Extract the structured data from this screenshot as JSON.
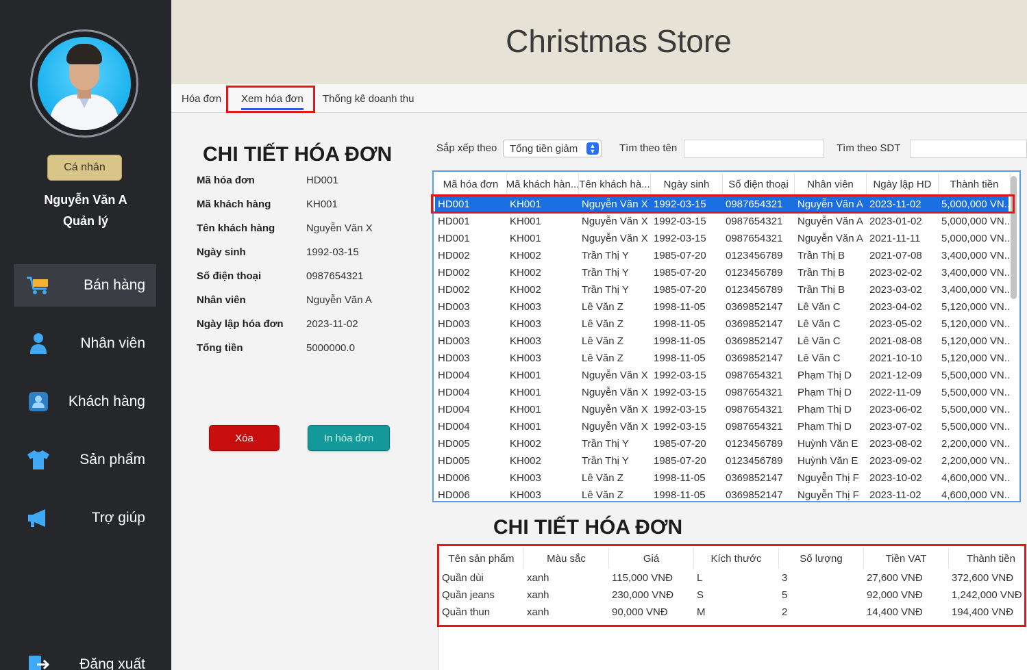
{
  "app": {
    "title": "Christmas Store"
  },
  "user": {
    "personal_label": "Cá nhân",
    "name": "Nguyễn Văn A",
    "role": "Quản lý"
  },
  "nav": [
    {
      "label": "Bán hàng",
      "icon": "cart-icon"
    },
    {
      "label": "Nhân viên",
      "icon": "person-icon"
    },
    {
      "label": "Khách hàng",
      "icon": "customer-icon"
    },
    {
      "label": "Sản phẩm",
      "icon": "shirt-icon"
    },
    {
      "label": "Trợ giúp",
      "icon": "megaphone-icon"
    },
    {
      "label": "Đăng xuất",
      "icon": "logout-icon"
    }
  ],
  "tabs": [
    {
      "label": "Hóa đơn"
    },
    {
      "label": "Xem hóa đơn",
      "active": true
    },
    {
      "label": "Thống kê doanh thu"
    }
  ],
  "detail": {
    "title": "CHI TIẾT HÓA ĐƠN",
    "fields": [
      {
        "label": "Mã hóa đơn",
        "value": "HD001"
      },
      {
        "label": "Mã khách hàng",
        "value": "KH001"
      },
      {
        "label": "Tên khách hàng",
        "value": "Nguyễn Văn X"
      },
      {
        "label": "Ngày sinh",
        "value": "1992-03-15"
      },
      {
        "label": "Số điện thoại",
        "value": "0987654321"
      },
      {
        "label": "Nhân viên",
        "value": "Nguyễn Văn A"
      },
      {
        "label": "Ngày lập hóa đơn",
        "value": "2023-11-02"
      },
      {
        "label": "Tổng tiền",
        "value": "5000000.0"
      }
    ],
    "delete_label": "Xóa",
    "print_label": "In hóa đơn"
  },
  "toolbar": {
    "sort_label": "Sắp xếp theo",
    "sort_value": "Tổng tiền giảm",
    "search_name_label": "Tìm theo tên",
    "search_name_value": "",
    "search_phone_label": "Tìm theo SDT",
    "search_phone_value": ""
  },
  "invoice_table": {
    "columns": [
      "Mã hóa đơn",
      "Mã khách hàn...",
      "Tên khách hà...",
      "Ngày sinh",
      "Số điện thoại",
      "Nhân viên",
      "Ngày lập HD",
      "Thành tiền"
    ],
    "selected_row": 0,
    "rows": [
      [
        "HD001",
        "KH001",
        "Nguyễn Văn X",
        "1992-03-15",
        "0987654321",
        "Nguyễn Văn A",
        "2023-11-02",
        "5,000,000 VN..."
      ],
      [
        "HD001",
        "KH001",
        "Nguyễn Văn X",
        "1992-03-15",
        "0987654321",
        "Nguyễn Văn A",
        "2023-01-02",
        "5,000,000 VN..."
      ],
      [
        "HD001",
        "KH001",
        "Nguyễn Văn X",
        "1992-03-15",
        "0987654321",
        "Nguyễn Văn A",
        "2021-11-11",
        "5,000,000 VN..."
      ],
      [
        "HD002",
        "KH002",
        "Trần Thị Y",
        "1985-07-20",
        "0123456789",
        "Trần Thị B",
        "2021-07-08",
        "3,400,000 VN..."
      ],
      [
        "HD002",
        "KH002",
        "Trần Thị Y",
        "1985-07-20",
        "0123456789",
        "Trần Thị B",
        "2023-02-02",
        "3,400,000 VN..."
      ],
      [
        "HD002",
        "KH002",
        "Trần Thị Y",
        "1985-07-20",
        "0123456789",
        "Trần Thị B",
        "2023-03-02",
        "3,400,000 VN..."
      ],
      [
        "HD003",
        "KH003",
        "Lê Văn Z",
        "1998-11-05",
        "0369852147",
        "Lê Văn C",
        "2023-04-02",
        "5,120,000 VN..."
      ],
      [
        "HD003",
        "KH003",
        "Lê Văn Z",
        "1998-11-05",
        "0369852147",
        "Lê Văn C",
        "2023-05-02",
        "5,120,000 VN..."
      ],
      [
        "HD003",
        "KH003",
        "Lê Văn Z",
        "1998-11-05",
        "0369852147",
        "Lê Văn C",
        "2021-08-08",
        "5,120,000 VN..."
      ],
      [
        "HD003",
        "KH003",
        "Lê Văn Z",
        "1998-11-05",
        "0369852147",
        "Lê Văn C",
        "2021-10-10",
        "5,120,000 VN..."
      ],
      [
        "HD004",
        "KH001",
        "Nguyễn Văn X",
        "1992-03-15",
        "0987654321",
        "Phạm Thị D",
        "2021-12-09",
        "5,500,000 VN..."
      ],
      [
        "HD004",
        "KH001",
        "Nguyễn Văn X",
        "1992-03-15",
        "0987654321",
        "Phạm Thị D",
        "2022-11-09",
        "5,500,000 VN..."
      ],
      [
        "HD004",
        "KH001",
        "Nguyễn Văn X",
        "1992-03-15",
        "0987654321",
        "Phạm Thị D",
        "2023-06-02",
        "5,500,000 VN..."
      ],
      [
        "HD004",
        "KH001",
        "Nguyễn Văn X",
        "1992-03-15",
        "0987654321",
        "Phạm Thị D",
        "2023-07-02",
        "5,500,000 VN..."
      ],
      [
        "HD005",
        "KH002",
        "Trần Thị Y",
        "1985-07-20",
        "0123456789",
        "Huỳnh Văn E",
        "2023-08-02",
        "2,200,000 VN..."
      ],
      [
        "HD005",
        "KH002",
        "Trần Thị Y",
        "1985-07-20",
        "0123456789",
        "Huỳnh Văn E",
        "2023-09-02",
        "2,200,000 VN..."
      ],
      [
        "HD006",
        "KH003",
        "Lê Văn Z",
        "1998-11-05",
        "0369852147",
        "Nguyễn Thị F",
        "2023-10-02",
        "4,600,000 VN..."
      ],
      [
        "HD006",
        "KH003",
        "Lê Văn Z",
        "1998-11-05",
        "0369852147",
        "Nguyễn Thị F",
        "2023-11-02",
        "4,600,000 VN..."
      ]
    ]
  },
  "product_detail": {
    "title": "CHI TIẾT HÓA ĐƠN",
    "columns": [
      "Tên sản phẩm",
      "Màu sắc",
      "Giá",
      "Kích thước",
      "Số lượng",
      "Tiền VAT",
      "Thành tiền"
    ],
    "rows": [
      [
        "Quần dùi",
        "xanh",
        "115,000 VNĐ",
        "L",
        "3",
        "27,600 VNĐ",
        "372,600 VNĐ"
      ],
      [
        "Quần jeans",
        "xanh",
        "230,000 VNĐ",
        "S",
        "5",
        "92,000 VNĐ",
        "1,242,000 VNĐ"
      ],
      [
        "Quần thun",
        "xanh",
        "90,000 VNĐ",
        "M",
        "2",
        "14,400 VNĐ",
        "194,400 VNĐ"
      ]
    ]
  },
  "colors": {
    "sidebar": "#25272b",
    "header": "#e6e3d6",
    "accent": "#1a6fe0",
    "highlight": "#e01818",
    "delete": "#c80e0e",
    "print": "#14999a",
    "personal": "#d9c588"
  }
}
